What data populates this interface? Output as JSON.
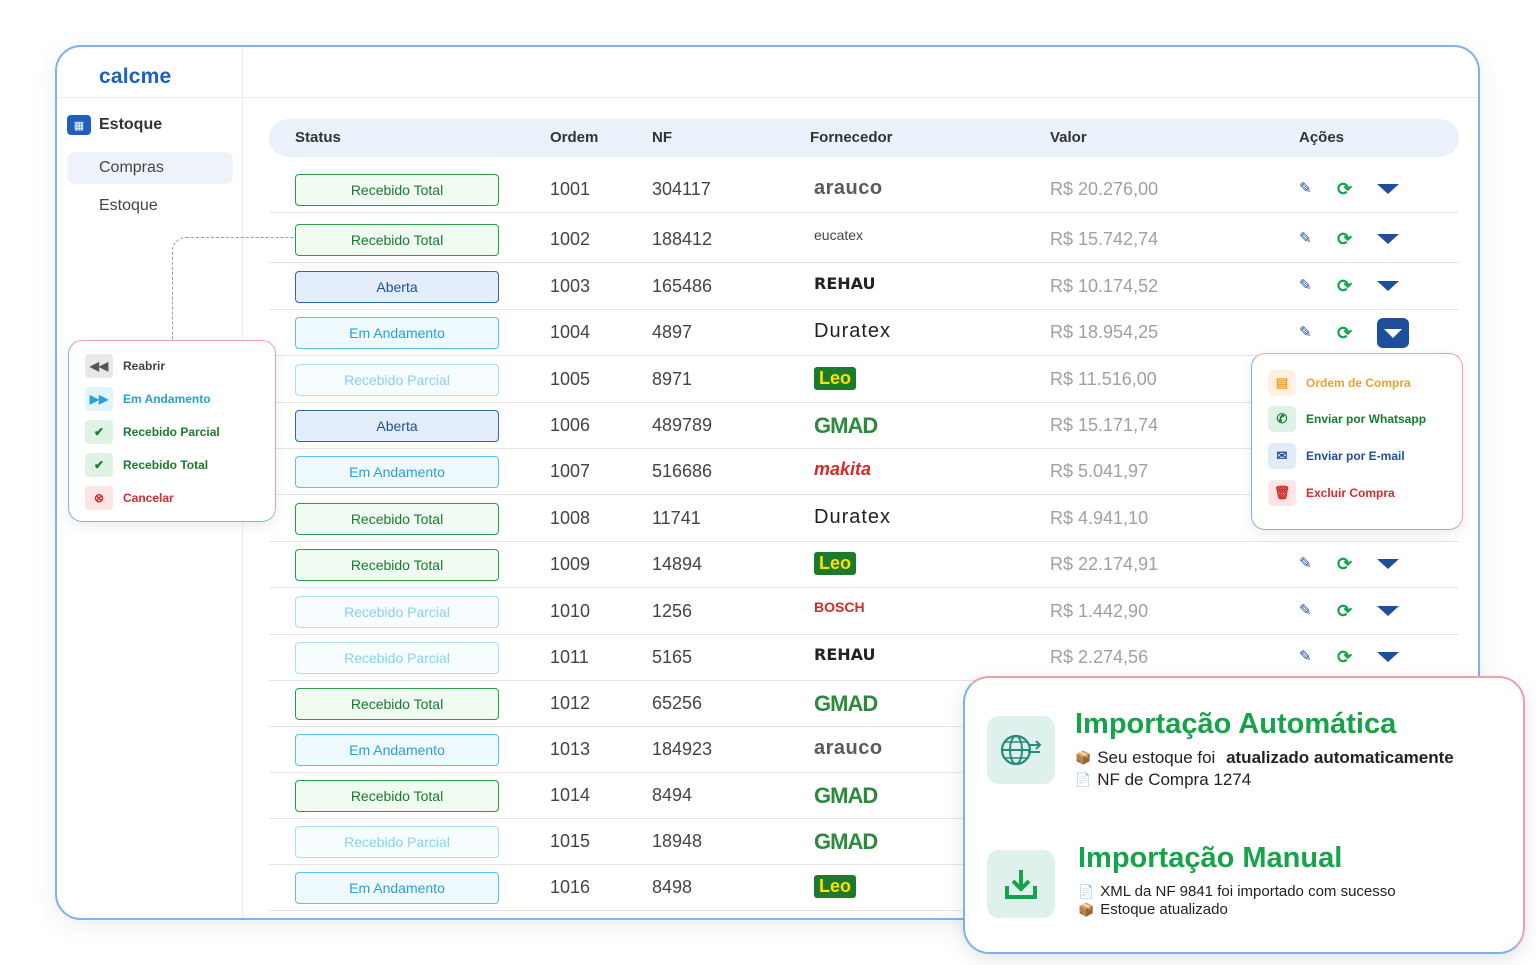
{
  "app": {
    "logo": "calcme"
  },
  "sidebar": {
    "section_label": "Estoque",
    "items": [
      {
        "label": "Compras",
        "active": true
      },
      {
        "label": "Estoque",
        "active": false
      }
    ]
  },
  "table": {
    "headers": {
      "status": "Status",
      "ordem": "Ordem",
      "nf": "NF",
      "fornecedor": "Fornecedor",
      "valor": "Valor",
      "acoes": "Ações"
    },
    "rows": [
      {
        "status": "Recebido Total",
        "kind": "total",
        "ordem": "1001",
        "nf": "304117",
        "fornecedor": "arauco",
        "brand": "arauco",
        "valor": "R$ 20.276,00"
      },
      {
        "status": "Recebido Total",
        "kind": "total",
        "ordem": "1002",
        "nf": "188412",
        "fornecedor": "eucatex",
        "brand": "eucatex",
        "valor": "R$ 15.742,74"
      },
      {
        "status": "Aberta",
        "kind": "aberta",
        "ordem": "1003",
        "nf": "165486",
        "fornecedor": "REHAU",
        "brand": "rehau",
        "valor": "R$ 10.174,52"
      },
      {
        "status": "Em Andamento",
        "kind": "andamento",
        "ordem": "1004",
        "nf": "4897",
        "fornecedor": "Duratex",
        "brand": "duratex",
        "valor": "R$ 18.954,25"
      },
      {
        "status": "Recebido Parcial",
        "kind": "parcial",
        "ordem": "1005",
        "nf": "8971",
        "fornecedor": "Leo",
        "brand": "leo",
        "valor": "R$ 11.516,00"
      },
      {
        "status": "Aberta",
        "kind": "aberta",
        "ordem": "1006",
        "nf": "489789",
        "fornecedor": "GMAD",
        "brand": "gmad",
        "valor": "R$ 15.171,74"
      },
      {
        "status": "Em Andamento",
        "kind": "andamento",
        "ordem": "1007",
        "nf": "516686",
        "fornecedor": "makita",
        "brand": "makita",
        "valor": "R$ 5.041,97"
      },
      {
        "status": "Recebido Total",
        "kind": "total",
        "ordem": "1008",
        "nf": "11741",
        "fornecedor": "Duratex",
        "brand": "duratex",
        "valor": "R$ 4.941,10"
      },
      {
        "status": "Recebido Total",
        "kind": "total",
        "ordem": "1009",
        "nf": "14894",
        "fornecedor": "Leo",
        "brand": "leo",
        "valor": "R$ 22.174,91"
      },
      {
        "status": "Recebido Parcial",
        "kind": "parcial",
        "ordem": "1010",
        "nf": "1256",
        "fornecedor": "BOSCH",
        "brand": "bosch",
        "valor": "R$ 1.442,90"
      },
      {
        "status": "Recebido Parcial",
        "kind": "parcial",
        "ordem": "1011",
        "nf": "5165",
        "fornecedor": "REHAU",
        "brand": "rehau",
        "valor": "R$ 2.274,56"
      },
      {
        "status": "Recebido Total",
        "kind": "total",
        "ordem": "1012",
        "nf": "65256",
        "fornecedor": "GMAD",
        "brand": "gmad",
        "valor": ""
      },
      {
        "status": "Em Andamento",
        "kind": "andamento",
        "ordem": "1013",
        "nf": "184923",
        "fornecedor": "arauco",
        "brand": "arauco",
        "valor": ""
      },
      {
        "status": "Recebido Total",
        "kind": "total",
        "ordem": "1014",
        "nf": "8494",
        "fornecedor": "GMAD",
        "brand": "gmad",
        "valor": ""
      },
      {
        "status": "Recebido Parcial",
        "kind": "parcial",
        "ordem": "1015",
        "nf": "18948",
        "fornecedor": "GMAD",
        "brand": "gmad",
        "valor": ""
      },
      {
        "status": "Em Andamento",
        "kind": "andamento",
        "ordem": "1016",
        "nf": "8498",
        "fornecedor": "Leo",
        "brand": "leo",
        "valor": ""
      }
    ]
  },
  "status_menu": {
    "items": [
      {
        "label": "Reabrir",
        "icon": "rewind-icon",
        "color": "#444444"
      },
      {
        "label": "Em Andamento",
        "icon": "fast-forward-icon",
        "color": "#2a9fd1"
      },
      {
        "label": "Recebido Parcial",
        "icon": "check-icon",
        "color": "#1a7a2e"
      },
      {
        "label": "Recebido Total",
        "icon": "check-icon",
        "color": "#1a7a2e"
      },
      {
        "label": "Cancelar",
        "icon": "cancel-icon",
        "color": "#d42a2a"
      }
    ]
  },
  "actions_menu": {
    "items": [
      {
        "label": "Ordem de Compra",
        "icon": "document-icon",
        "color": "#f0a030"
      },
      {
        "label": "Enviar por Whatsapp",
        "icon": "whatsapp-icon",
        "color": "#1a7a2e"
      },
      {
        "label": "Enviar por E-mail",
        "icon": "mail-icon",
        "color": "#1e4f9a"
      },
      {
        "label": "Excluir Compra",
        "icon": "trash-icon",
        "color": "#d42a2a"
      }
    ]
  },
  "import_card": {
    "auto": {
      "title": "Importação Automática",
      "line1_prefix": "Seu estoque foi ",
      "line1_bold": "atualizado automaticamente",
      "line2": "NF de Compra 1274"
    },
    "manual": {
      "title": "Importação Manual",
      "line1": "XML da NF 9841 foi importado com sucesso",
      "line2": "Estoque atualizado"
    }
  },
  "colors": {
    "accent": "#1e5fbf",
    "green": "#17a34a",
    "border_blue": "#7fb2e8",
    "border_pink": "#f2a0a8"
  }
}
